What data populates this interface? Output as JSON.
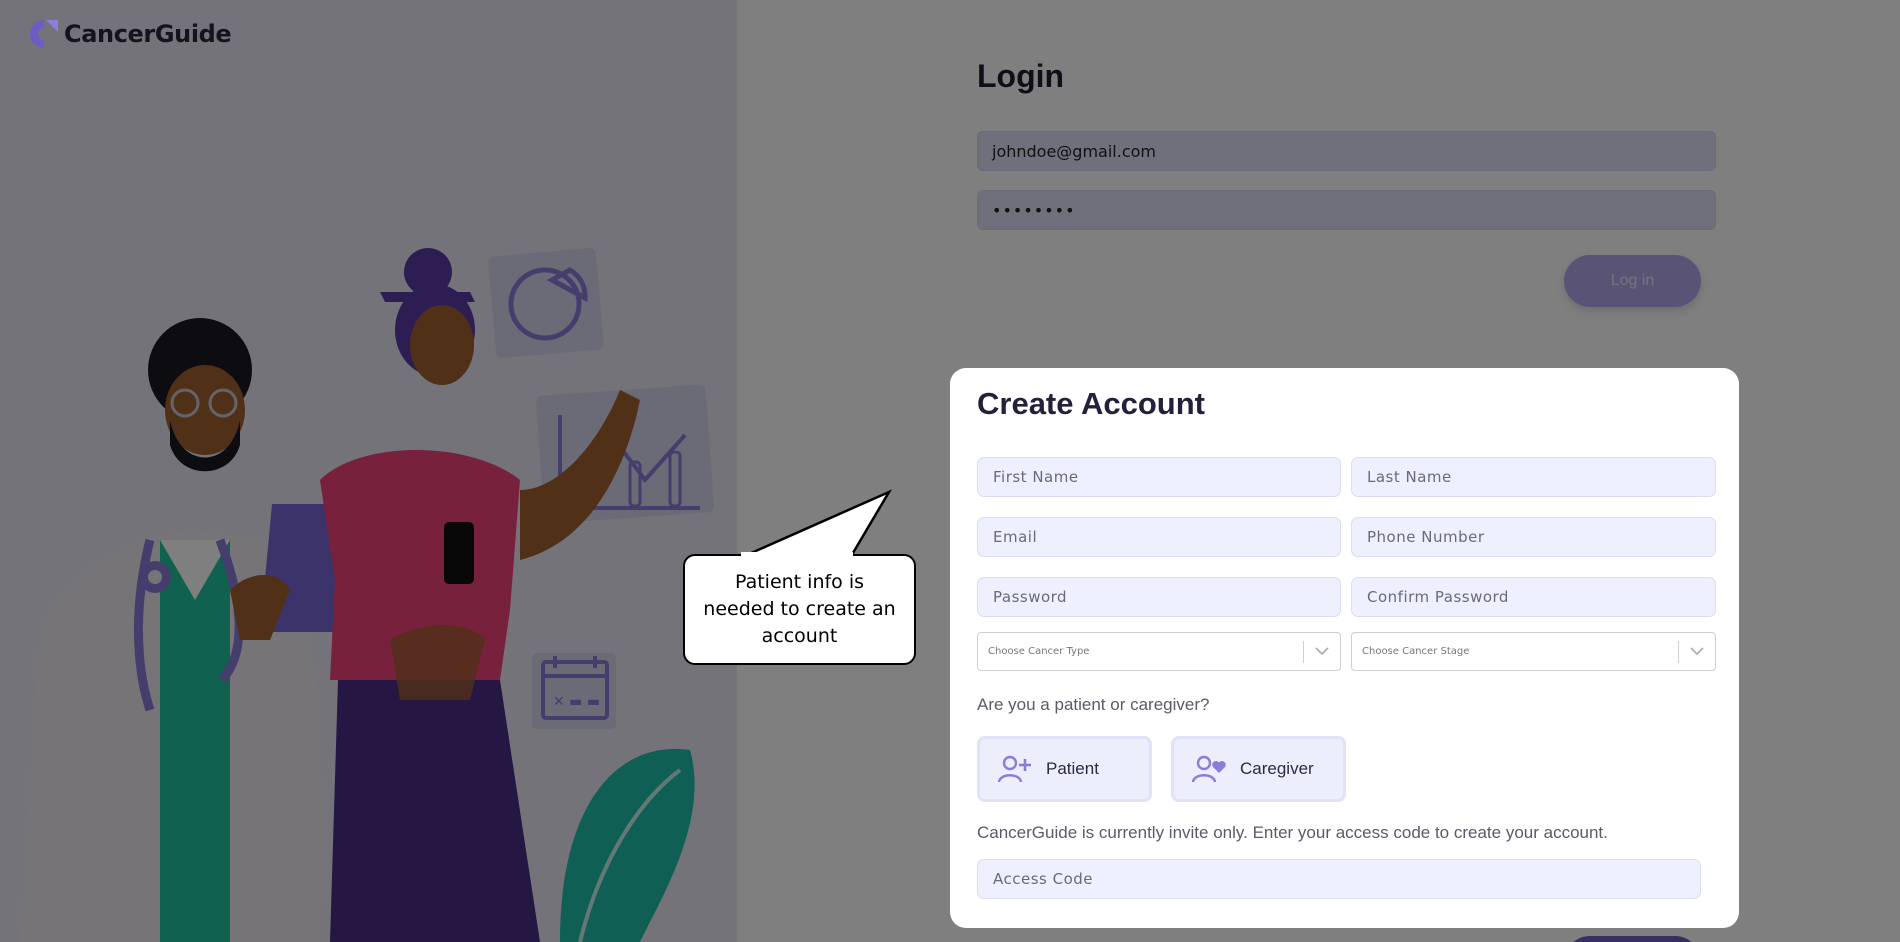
{
  "brand": {
    "name": "CancerGuide",
    "logo_icon": "cancerguide-logo-icon",
    "color_primary": "#6e5cc4"
  },
  "login": {
    "title": "Login",
    "email_value": "johndoe@gmail.com",
    "password_mask": "••••••••",
    "submit_label": "Log in"
  },
  "create_account": {
    "title": "Create Account",
    "fields": {
      "first_name": "First Name",
      "last_name": "Last Name",
      "email": "Email",
      "phone": "Phone Number",
      "password": "Password",
      "confirm_password": "Confirm Password"
    },
    "cancer_type_placeholder": "Choose Cancer Type",
    "cancer_stage_placeholder": "Choose Cancer Stage",
    "role_question": "Are you a patient or caregiver?",
    "roles": [
      {
        "label": "Patient",
        "icon": "user-plus-icon"
      },
      {
        "label": "Caregiver",
        "icon": "user-heart-icon"
      }
    ],
    "invite_text": "CancerGuide is currently invite only. Enter your access code to create your account.",
    "access_code_placeholder": "Access Code"
  },
  "callout": {
    "text": "Patient info is needed to create an account"
  },
  "illustration": {
    "icons": [
      "pie-chart-icon",
      "line-chart-icon",
      "calendar-icon"
    ]
  }
}
